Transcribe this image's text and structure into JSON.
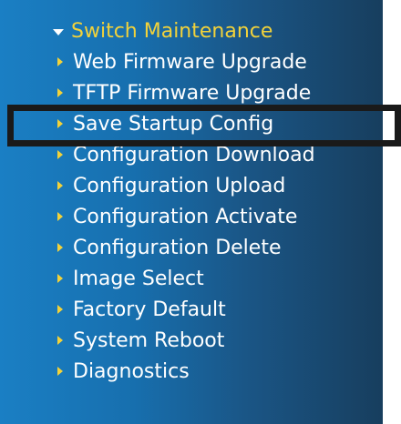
{
  "menu": {
    "header_label": "Switch Maintenance",
    "items": [
      {
        "label": "Web Firmware Upgrade"
      },
      {
        "label": "TFTP Firmware Upgrade"
      },
      {
        "label": "Save Startup Config"
      },
      {
        "label": "Configuration Download"
      },
      {
        "label": "Configuration Upload"
      },
      {
        "label": "Configuration Activate"
      },
      {
        "label": "Configuration Delete"
      },
      {
        "label": "Image Select"
      },
      {
        "label": "Factory Default"
      },
      {
        "label": "System Reboot"
      },
      {
        "label": "Diagnostics"
      }
    ]
  },
  "colors": {
    "header_text": "#f2d23a",
    "item_text": "#ffffff",
    "arrow": "#f2d23a",
    "highlight_border": "#1a1a1a"
  },
  "icons": {
    "header": "caret-down-icon",
    "item": "caret-right-icon"
  }
}
